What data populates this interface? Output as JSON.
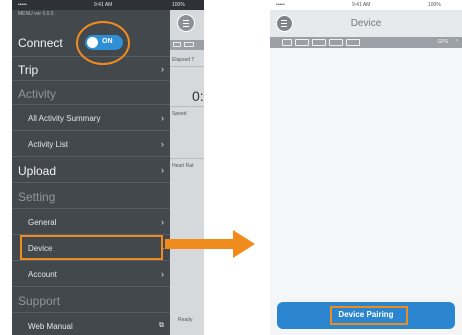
{
  "left_phone": {
    "status": {
      "carrier": "•••••  ",
      "time": "9:41 AM",
      "battery": "100%"
    },
    "version": "MENU  ver 0.0.0",
    "connect": {
      "label": "Connect",
      "toggle_text": "ON"
    },
    "menu": {
      "trip": "Trip",
      "activity_header": "Activity",
      "all_activity_summary": "All Activity Summary",
      "activity_list": "Activity List",
      "upload": "Upload",
      "setting_header": "Setting",
      "general": "General",
      "device": "Device",
      "account": "Account",
      "support_header": "Support",
      "web_manual": "Web Manual"
    },
    "peek": {
      "elapsed": "Elapsed T",
      "value": "0:",
      "speed": "Speed",
      "heart": "Heart Rat",
      "ready": "Ready"
    }
  },
  "right_phone": {
    "status": {
      "carrier": "•••••  ",
      "time": "9:41 AM",
      "battery": "100%"
    },
    "title": "Device",
    "toolbar": {
      "gps": "GPS"
    },
    "pair_button": "Device Pairing"
  },
  "colors": {
    "accent": "#f08c1e",
    "blue": "#2b86cf",
    "menu_bg": "#43484d"
  },
  "icons": {
    "menu": "hamburger-icon",
    "chevron": "chevron-right-icon",
    "external": "external-link-icon",
    "arrow": "arrow-right-icon"
  }
}
